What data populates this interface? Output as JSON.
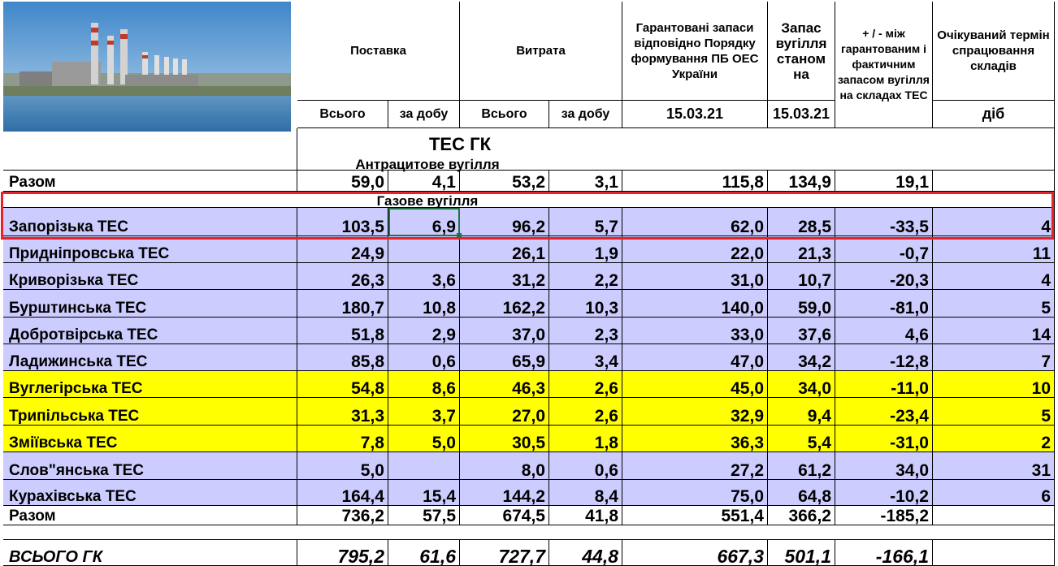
{
  "image": {
    "name": "power-plant-photo"
  },
  "header": {
    "supply": "Поставка",
    "consumption": "Витрата",
    "guaranteed": "Гарантовані запаси відповідно Порядку формування ПБ ОЕС України",
    "stock": "Запас вугілля станом на",
    "diff": "+ / - між гарантованим і фактичним запасом вугілля на складах ТЕС",
    "expected": "Очікуваний термін спрацювання складів",
    "total": "Всього",
    "per_day": "за добу",
    "total2": "Всього",
    "per_day2": "за добу",
    "date1": "15.03.21",
    "date2": "15.03.21",
    "days": "діб"
  },
  "sections": {
    "tes_gk": "ТЕС ГК",
    "anthracite": "Антрацитове вугілля",
    "gas": "Газове вугілля"
  },
  "anthracite_total": {
    "name": "Разом",
    "v": [
      "59,0",
      "4,1",
      "53,2",
      "3,1",
      "115,8",
      "134,9",
      "19,1",
      ""
    ]
  },
  "rows": [
    {
      "name": "Запорізька ТЕС",
      "v": [
        "103,5",
        "6,9",
        "96,2",
        "5,7",
        "62,0",
        "28,5",
        "-33,5",
        "4"
      ]
    },
    {
      "name": "Придніпровська ТЕС",
      "v": [
        "24,9",
        "",
        "26,1",
        "1,9",
        "22,0",
        "21,3",
        "-0,7",
        "11"
      ]
    },
    {
      "name": "Криворізька ТЕС",
      "v": [
        "26,3",
        "3,6",
        "31,2",
        "2,2",
        "31,0",
        "10,7",
        "-20,3",
        "4"
      ]
    },
    {
      "name": "Бурштинська ТЕС",
      "v": [
        "180,7",
        "10,8",
        "162,2",
        "10,3",
        "140,0",
        "59,0",
        "-81,0",
        "5"
      ]
    },
    {
      "name": "Добротвірська ТЕС",
      "v": [
        "51,8",
        "2,9",
        "37,0",
        "2,3",
        "33,0",
        "37,6",
        "4,6",
        "14"
      ]
    },
    {
      "name": "Ладижинська ТЕС",
      "v": [
        "85,8",
        "0,6",
        "65,9",
        "3,4",
        "47,0",
        "34,2",
        "-12,8",
        "7"
      ]
    },
    {
      "name": "Вуглегірська ТЕС",
      "v": [
        "54,8",
        "8,6",
        "46,3",
        "2,6",
        "45,0",
        "34,0",
        "-11,0",
        "10"
      ]
    },
    {
      "name": "Трипільська ТЕС",
      "v": [
        "31,3",
        "3,7",
        "27,0",
        "2,6",
        "32,9",
        "9,4",
        "-23,4",
        "5"
      ]
    },
    {
      "name": "Зміївська ТЕС",
      "v": [
        "7,8",
        "5,0",
        "30,5",
        "1,8",
        "36,3",
        "5,4",
        "-31,0",
        "2"
      ]
    },
    {
      "name": "Слов\"янська ТЕС",
      "v": [
        "5,0",
        "",
        "8,0",
        "0,6",
        "27,2",
        "61,2",
        "34,0",
        "31"
      ]
    },
    {
      "name": "Курахівська ТЕС",
      "v": [
        "164,4",
        "15,4",
        "144,2",
        "8,4",
        "75,0",
        "64,8",
        "-10,2",
        "6"
      ]
    }
  ],
  "gas_total": {
    "name": "Разом",
    "v": [
      "736,2",
      "57,5",
      "674,5",
      "41,8",
      "551,4",
      "366,2",
      "-185,2",
      ""
    ]
  },
  "grand_total": {
    "name": "ВСЬОГО ГК",
    "v": [
      "795,2",
      "61,6",
      "727,7",
      "44,8",
      "667,3",
      "501,1",
      "-166,1",
      ""
    ]
  },
  "colors": {
    "lavender": "#ccccff",
    "yellow": "#ffff00",
    "highlight": "#e8212b",
    "selection": "#217346"
  }
}
